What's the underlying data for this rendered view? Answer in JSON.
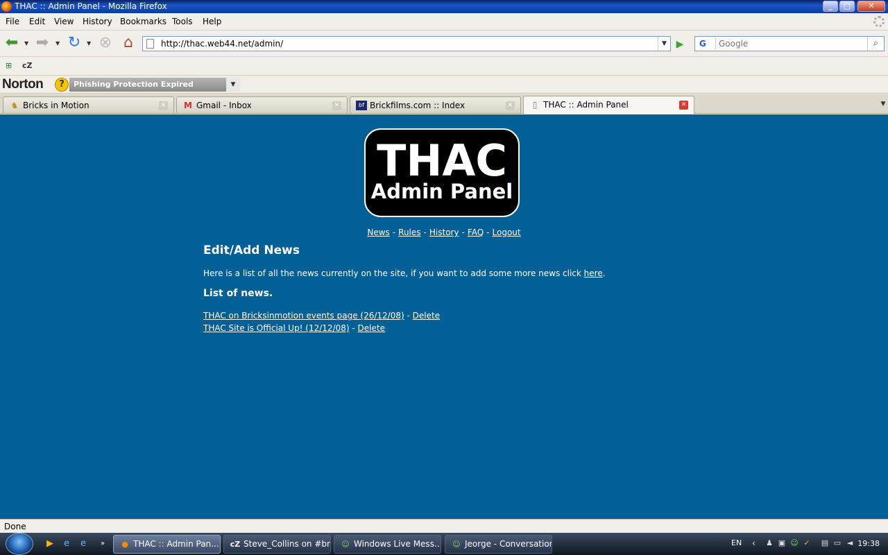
{
  "window": {
    "title": "THAC :: Admin Panel - Mozilla Firefox",
    "controls": [
      "minimize",
      "maximize",
      "close"
    ]
  },
  "menu": [
    "File",
    "Edit",
    "View",
    "History",
    "Bookmarks",
    "Tools",
    "Help"
  ],
  "nav": {
    "url": "http://thac.web44.net/admin/",
    "search_engine": "G",
    "search_placeholder": "Google"
  },
  "norton": {
    "logo": "Norton",
    "alert": "Phishing Protection Expired"
  },
  "tabs": [
    {
      "label": "Bricks in Motion",
      "icon": "bim-icon"
    },
    {
      "label": "Gmail - Inbox",
      "icon": "gmail-icon"
    },
    {
      "label": "Brickfilms.com :: Index",
      "icon": "bf-icon"
    },
    {
      "label": "THAC :: Admin Panel",
      "icon": "page-icon",
      "active": true
    }
  ],
  "page": {
    "logo_big": "THAC",
    "logo_small": "Admin Panel",
    "nav_links": [
      "News",
      "Rules",
      "History",
      "FAQ",
      "Logout"
    ],
    "heading": "Edit/Add News",
    "intro_before": "Here is a list of all the news currently on the site, if you want to add some more news click ",
    "intro_link": "here",
    "intro_after": ".",
    "list_heading": "List of news.",
    "news": [
      {
        "title": "THAC on Bricksinmotion events page (26/12/08)",
        "action": "Delete"
      },
      {
        "title": "THAC Site is Official Up! (12/12/08)",
        "action": "Delete"
      }
    ],
    "background": "#036096"
  },
  "status": "Done",
  "taskbar": {
    "windows": [
      {
        "label": "THAC :: Admin Pan...",
        "icon": "firefox-icon",
        "active": true
      },
      {
        "label": "Steve_Collins on #br...",
        "icon": "chatzilla-icon"
      },
      {
        "label": "Windows Live Mess...",
        "icon": "messenger-icon"
      },
      {
        "label": "Jeorge - Conversation",
        "icon": "messenger-icon"
      }
    ],
    "lang": "EN",
    "clock": "19:38"
  }
}
